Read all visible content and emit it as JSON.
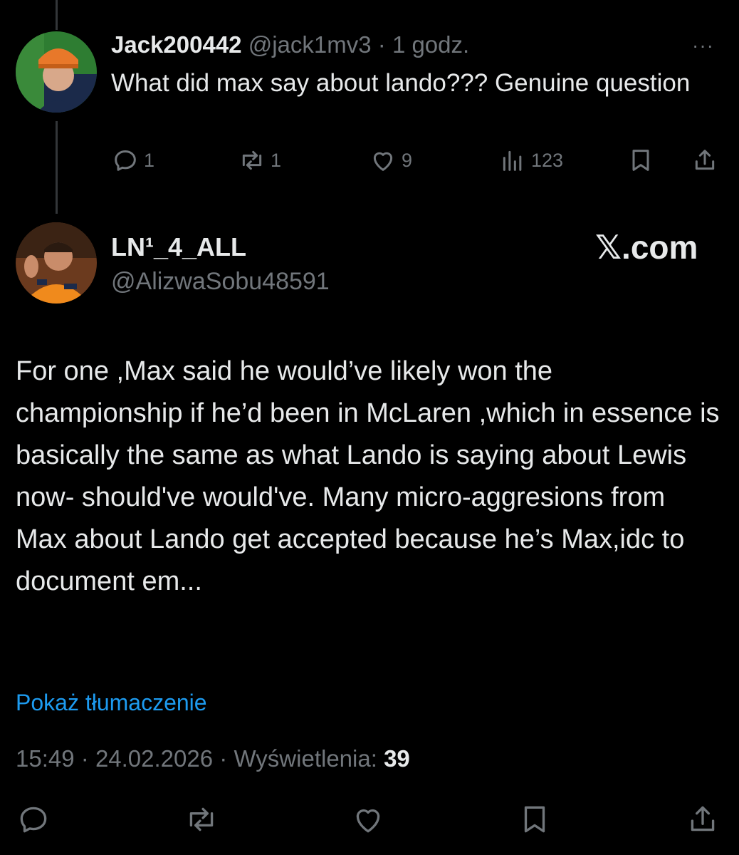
{
  "reply": {
    "name": "Jack200442",
    "handle": "@jack1mv3",
    "separator": "·",
    "time": "1 godz.",
    "more": "···",
    "text": "What did max say about lando??? Genuine question",
    "stats": {
      "replies": "1",
      "reposts": "1",
      "likes": "9",
      "views": "123"
    }
  },
  "post": {
    "name": "LN¹_4_ALL",
    "handle": "@AlizwaSobu48591",
    "brand": "𝕏.com",
    "text": "For one ,Max said he would’ve likely won the championship if he’d been in McLaren ,which in essence is  basically the same as what Lando is saying about Lewis now- should've would've. Many micro-aggresions from Max about Lando get accepted because he’s Max,idc to document em...",
    "translate_label": "Pokaż tłumaczenie",
    "time": "15:49",
    "date": "24.02.2026",
    "views_label": "Wyświetlenia:",
    "views": "39"
  },
  "colors": {
    "background": "#000000",
    "text": "#e7e9ea",
    "muted": "#71767b",
    "link": "#1d9bf0"
  },
  "icons": [
    "reply-icon",
    "repost-icon",
    "like-icon",
    "views-icon",
    "bookmark-icon",
    "share-icon"
  ]
}
